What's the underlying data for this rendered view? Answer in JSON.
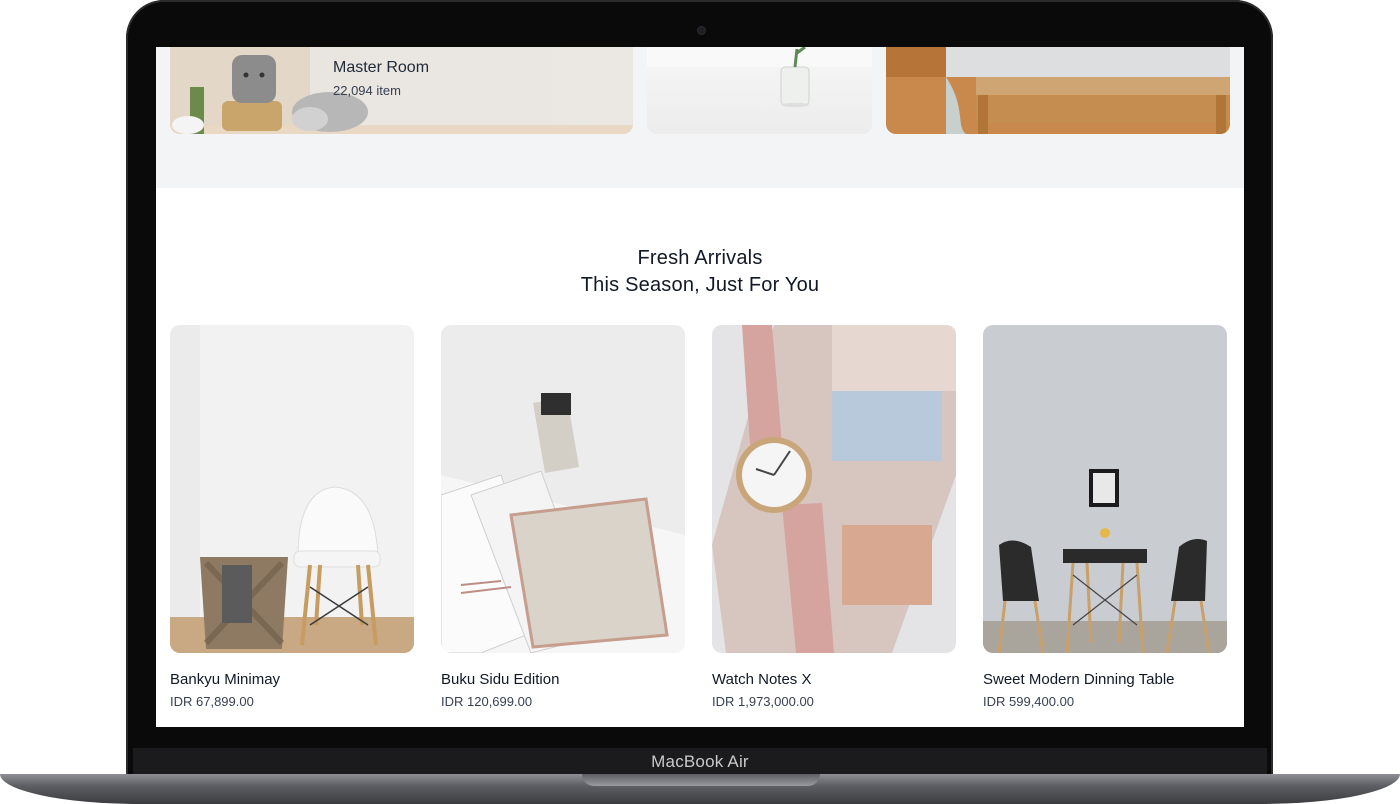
{
  "device": {
    "label": "MacBook Air"
  },
  "categories": [
    {
      "title": "Master Room",
      "count": "22,094 item"
    }
  ],
  "section": {
    "title": "Fresh Arrivals",
    "subtitle": "This Season, Just For You"
  },
  "products": [
    {
      "name": "Bankyu Minimay",
      "price": "IDR 67,899.00"
    },
    {
      "name": "Buku Sidu Edition",
      "price": "IDR 120,699.00"
    },
    {
      "name": "Watch Notes X",
      "price": "IDR 1,973,000.00"
    },
    {
      "name": "Sweet Modern Dinning Table",
      "price": "IDR 599,400.00"
    }
  ],
  "colors": {
    "page_bg": "#ffffff",
    "category_bg": "#f3f4f6",
    "text": "#111827"
  }
}
